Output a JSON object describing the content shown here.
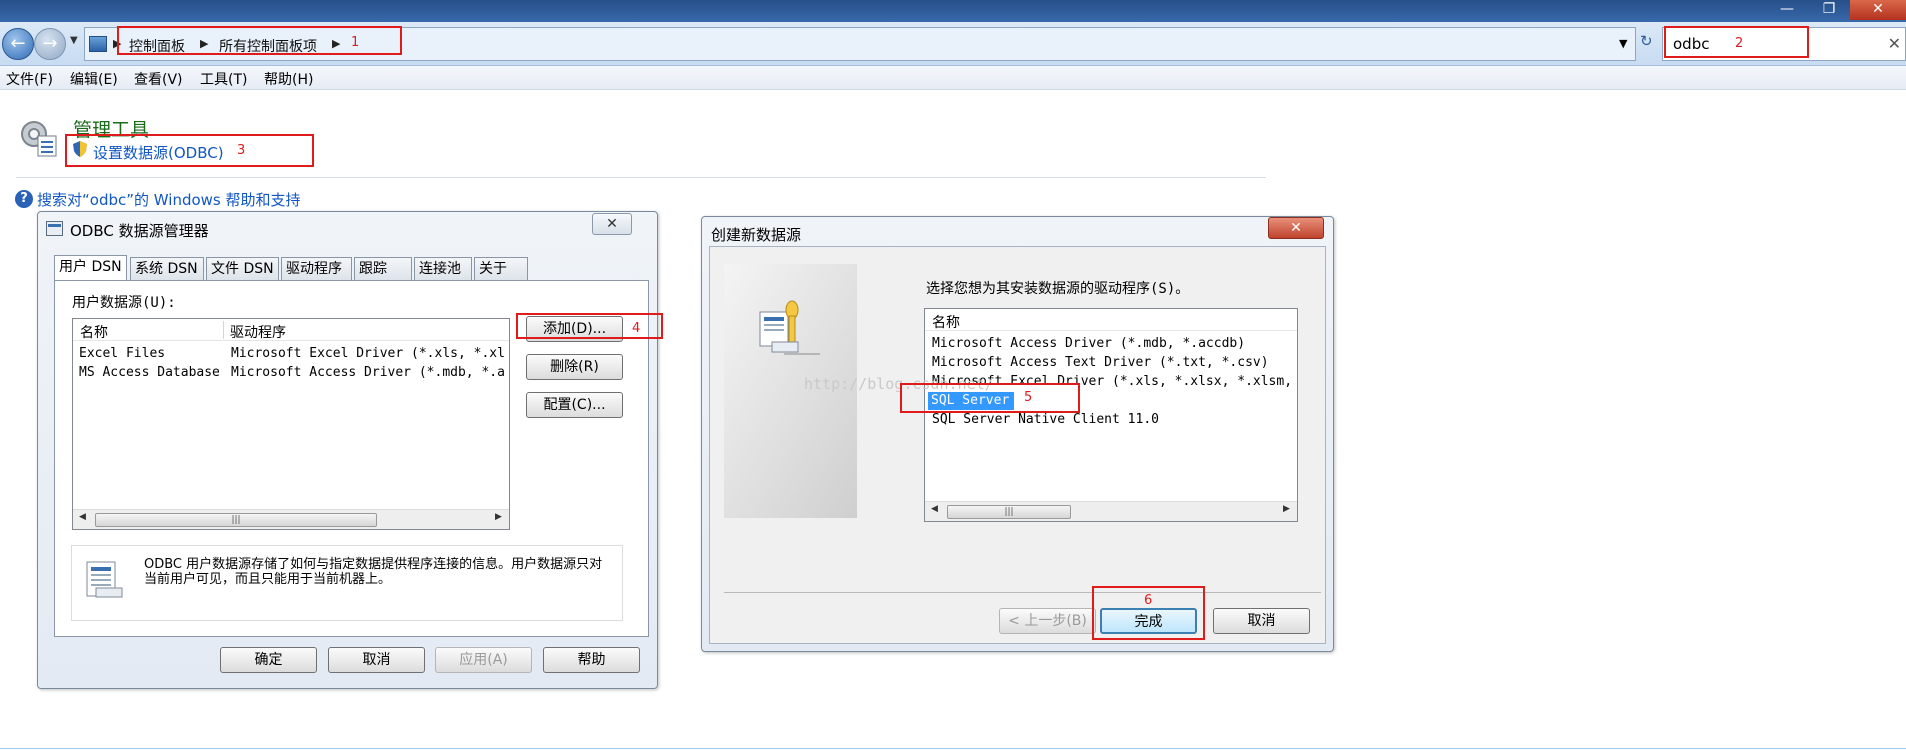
{
  "explorer": {
    "breadcrumb": [
      "控制面板",
      "所有控制面板项"
    ],
    "search_value": "odbc",
    "search_clear": "✕",
    "menu": [
      "文件(F)",
      "编辑(E)",
      "查看(V)",
      "工具(T)",
      "帮助(H)"
    ],
    "result_heading": "管理工具",
    "result_link": "设置数据源(ODBC)",
    "help_link": "搜索对“odbc”的 Windows 帮助和支持"
  },
  "annotations": [
    "1",
    "2",
    "3",
    "4",
    "5",
    "6"
  ],
  "odbc_dialog": {
    "title": "ODBC 数据源管理器",
    "tabs": [
      "用户 DSN",
      "系统 DSN",
      "文件 DSN",
      "驱动程序",
      "跟踪",
      "连接池",
      "关于"
    ],
    "list_label": "用户数据源(U):",
    "columns": [
      "名称",
      "驱动程序"
    ],
    "rows": [
      [
        "Excel Files",
        "Microsoft Excel Driver (*.xls, *.xl"
      ],
      [
        "MS Access Database",
        "Microsoft Access Driver (*.mdb, *.a"
      ]
    ],
    "side_buttons": [
      "添加(D)...",
      "删除(R)",
      "配置(C)..."
    ],
    "info_text": "ODBC 用户数据源存储了如何与指定数据提供程序连接的信息。用户数据源只对当前用户可见，而且只能用于当前机器上。",
    "buttons": {
      "ok": "确定",
      "cancel": "取消",
      "apply": "应用(A)",
      "help": "帮助"
    }
  },
  "new_source_dialog": {
    "title": "创建新数据源",
    "prompt": "选择您想为其安装数据源的驱动程序(S)。",
    "column": "名称",
    "drivers": [
      "Microsoft Access Driver (*.mdb, *.accdb)",
      "Microsoft Access Text Driver (*.txt, *.csv)",
      "Microsoft Excel Driver (*.xls, *.xlsx, *.xlsm,",
      "SQL Server",
      "SQL Server Native Client 11.0"
    ],
    "selected_driver": "SQL Server",
    "watermark": "http://blog.csdn.net/",
    "buttons": {
      "back": "< 上一步(B)",
      "finish": "完成",
      "cancel": "取消"
    }
  },
  "colors": {
    "annotation": "#e01b1b",
    "link": "#1156c4",
    "selection": "#3399ff",
    "heading": "#1a6b1a"
  }
}
